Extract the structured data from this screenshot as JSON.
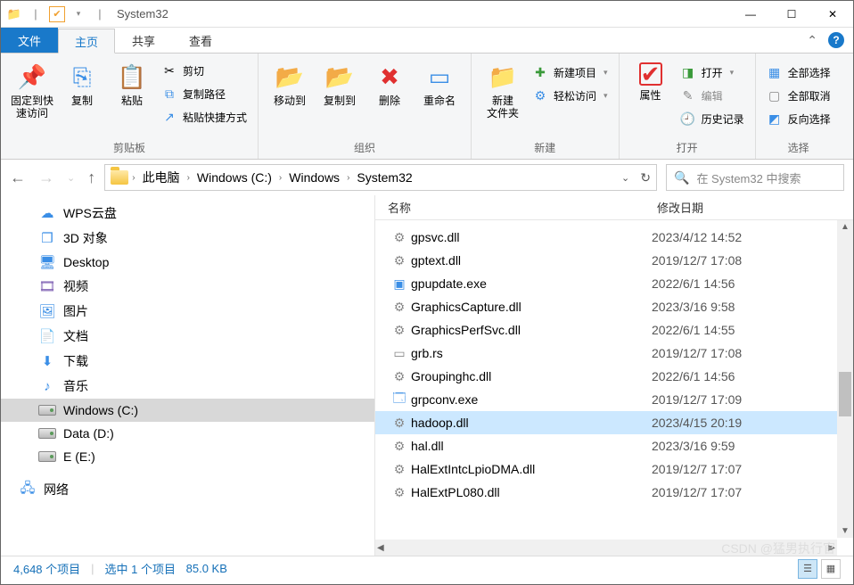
{
  "title": "System32",
  "tabs": {
    "file": "文件",
    "home": "主页",
    "share": "共享",
    "view": "查看"
  },
  "ribbon": {
    "clipboard": {
      "label": "剪贴板",
      "pin": "固定到快\n速访问",
      "copy": "复制",
      "paste": "粘贴",
      "cut": "剪切",
      "copypath": "复制路径",
      "pasteshortcut": "粘贴快捷方式"
    },
    "organize": {
      "label": "组织",
      "moveto": "移动到",
      "copyto": "复制到",
      "delete": "删除",
      "rename": "重命名"
    },
    "new": {
      "label": "新建",
      "newfolder": "新建\n文件夹",
      "newitem": "新建项目",
      "easyaccess": "轻松访问"
    },
    "open": {
      "label": "打开",
      "properties": "属性",
      "open": "打开",
      "edit": "编辑",
      "history": "历史记录"
    },
    "select": {
      "label": "选择",
      "selectall": "全部选择",
      "selectnone": "全部取消",
      "invert": "反向选择"
    }
  },
  "breadcrumb": [
    "此电脑",
    "Windows (C:)",
    "Windows",
    "System32"
  ],
  "refresh_tip": "刷新",
  "search_placeholder": "在 System32 中搜索",
  "sidebar": [
    {
      "icon": "cloud",
      "color": "c-blue",
      "label": "WPS云盘"
    },
    {
      "icon": "cube",
      "color": "c-blue",
      "label": "3D 对象"
    },
    {
      "icon": "desktop",
      "color": "c-blue",
      "label": "Desktop"
    },
    {
      "icon": "video",
      "color": "c-purple",
      "label": "视频"
    },
    {
      "icon": "picture",
      "color": "c-blue",
      "label": "图片"
    },
    {
      "icon": "doc",
      "color": "c-gray",
      "label": "文档"
    },
    {
      "icon": "download",
      "color": "c-blue",
      "label": "下载"
    },
    {
      "icon": "music",
      "color": "c-blue",
      "label": "音乐"
    },
    {
      "icon": "drive",
      "color": "",
      "label": "Windows (C:)",
      "sel": true
    },
    {
      "icon": "drive",
      "color": "",
      "label": "Data (D:)"
    },
    {
      "icon": "drive",
      "color": "",
      "label": "E (E:)"
    },
    {
      "icon": "network",
      "color": "c-blue",
      "label": "网络",
      "outdent": true
    }
  ],
  "columns": {
    "name": "名称",
    "date": "修改日期"
  },
  "files": [
    {
      "icon": "dll",
      "name": "gpsvc.dll",
      "date": "2023/4/12 14:52"
    },
    {
      "icon": "dll",
      "name": "gptext.dll",
      "date": "2019/12/7 17:08"
    },
    {
      "icon": "exe",
      "name": "gpupdate.exe",
      "date": "2022/6/1 14:56"
    },
    {
      "icon": "dll",
      "name": "GraphicsCapture.dll",
      "date": "2023/3/16 9:58"
    },
    {
      "icon": "dll",
      "name": "GraphicsPerfSvc.dll",
      "date": "2022/6/1 14:55"
    },
    {
      "icon": "file",
      "name": "grb.rs",
      "date": "2019/12/7 17:08"
    },
    {
      "icon": "dll",
      "name": "Groupinghc.dll",
      "date": "2022/6/1 14:56"
    },
    {
      "icon": "exe2",
      "name": "grpconv.exe",
      "date": "2019/12/7 17:09"
    },
    {
      "icon": "dll",
      "name": "hadoop.dll",
      "date": "2023/4/15 20:19",
      "sel": true
    },
    {
      "icon": "dll",
      "name": "hal.dll",
      "date": "2023/3/16 9:59"
    },
    {
      "icon": "dll",
      "name": "HalExtIntcLpioDMA.dll",
      "date": "2019/12/7 17:07"
    },
    {
      "icon": "dll",
      "name": "HalExtPL080.dll",
      "date": "2019/12/7 17:07"
    }
  ],
  "status": {
    "items": "4,648 个项目",
    "selected": "选中 1 个项目",
    "size": "85.0 KB"
  },
  "watermark": "CSDN @猛男执行官"
}
